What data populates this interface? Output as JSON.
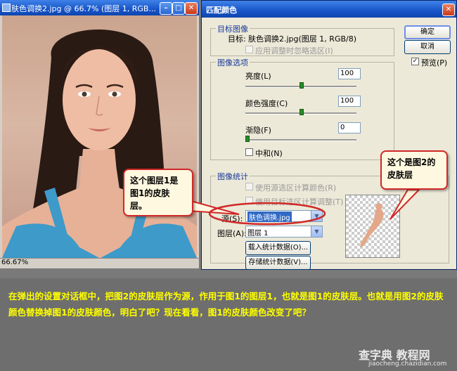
{
  "doc_window": {
    "title": "肤色调换2.jpg @ 66.7% (图层 1, RGB...",
    "zoom": "66.67%"
  },
  "dialog": {
    "title": "匹配颜色",
    "ok": "确定",
    "cancel": "取消",
    "preview_label": "预览(P)",
    "preview_checked": "✓",
    "target": {
      "group": "目标图像",
      "label": "目标:",
      "value": "肤色调换2.jpg(图层 1, RGB/8)",
      "ignore_selection": "应用调整时忽略选区(I)"
    },
    "options": {
      "group": "图像选项",
      "luminance_label": "亮度(L)",
      "luminance_value": "100",
      "intensity_label": "颜色强度(C)",
      "intensity_value": "100",
      "fade_label": "渐隐(F)",
      "fade_value": "0",
      "neutralize_label": "中和(N)"
    },
    "stats": {
      "group": "图像统计",
      "use_source_sel": "使用源选区计算颜色(R)",
      "use_target_sel": "使用目标选区计算调整(T)",
      "source_label": "源(S):",
      "source_value": "肤色调换.jpg",
      "layer_label": "图层(A):",
      "layer_value": "图层 1",
      "load_btn": "载入统计数据(O)...",
      "save_btn": "存储统计数据(V)..."
    }
  },
  "callouts": {
    "left": "这个图层1是图1的皮肤层。",
    "right": "这个是图2的皮肤层"
  },
  "caption": "在弹出的设置对话框中，把图2的皮肤层作为源，作用于图1的图层1，也就是图1的皮肤层。也就是用图2的皮肤颜色替换掉图1的皮肤颜色，明白了吧？现在看看，图1的皮肤颜色改变了吧？",
  "watermark": {
    "site_cn": "查字典 教程网",
    "site_url": "jiaocheng.chazidian.com"
  },
  "colors": {
    "callout_border": "#d02828",
    "caption_text": "#ffff00",
    "titlebar": "#1755c8"
  }
}
